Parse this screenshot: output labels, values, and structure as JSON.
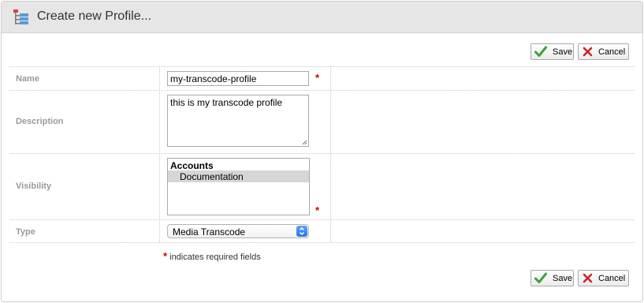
{
  "header": {
    "title": "Create new Profile..."
  },
  "toolbar": {
    "save_label": "Save",
    "cancel_label": "Cancel"
  },
  "form": {
    "name": {
      "label": "Name",
      "value": "my-transcode-profile"
    },
    "description": {
      "label": "Description",
      "value": "this is my transcode profile"
    },
    "visibility": {
      "label": "Visibility",
      "group": "Accounts",
      "items": [
        {
          "label": "Documentation",
          "selected": true
        }
      ]
    },
    "type": {
      "label": "Type",
      "value": "Media Transcode"
    }
  },
  "required_note": "indicates required fields",
  "required_mark": "*",
  "colors": {
    "required": "#cc0000",
    "check": "#3aa33a",
    "cross": "#cc2222",
    "select_accent": "#2a74e8"
  }
}
